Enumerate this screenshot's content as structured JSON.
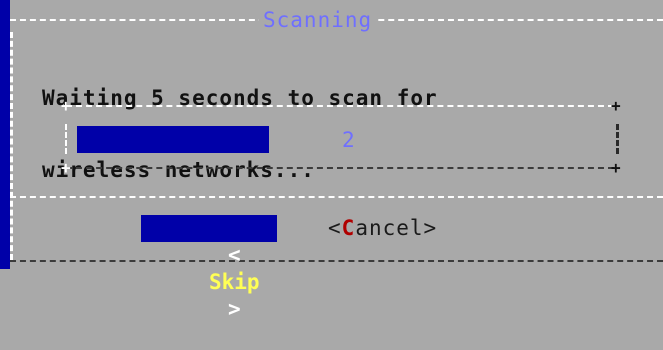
{
  "dialog": {
    "title": "Scanning",
    "message_line1": "Waiting 5 seconds to scan for",
    "message_line2": "wireless networks..."
  },
  "gauge": {
    "value_text": "2",
    "progress": 0.36
  },
  "buttons": {
    "skip": {
      "open": "<",
      "label": "Skip",
      "close": ">"
    },
    "cancel": {
      "open": "<",
      "hotkey": "C",
      "rest": "ancel",
      "close": ">"
    }
  },
  "colors": {
    "terminal_blue": "#0000a8",
    "dialog_gray": "#a9a9a9",
    "title_blue": "#6f6fff",
    "selected_text": "#ffff55",
    "hotkey_red": "#b00000"
  }
}
